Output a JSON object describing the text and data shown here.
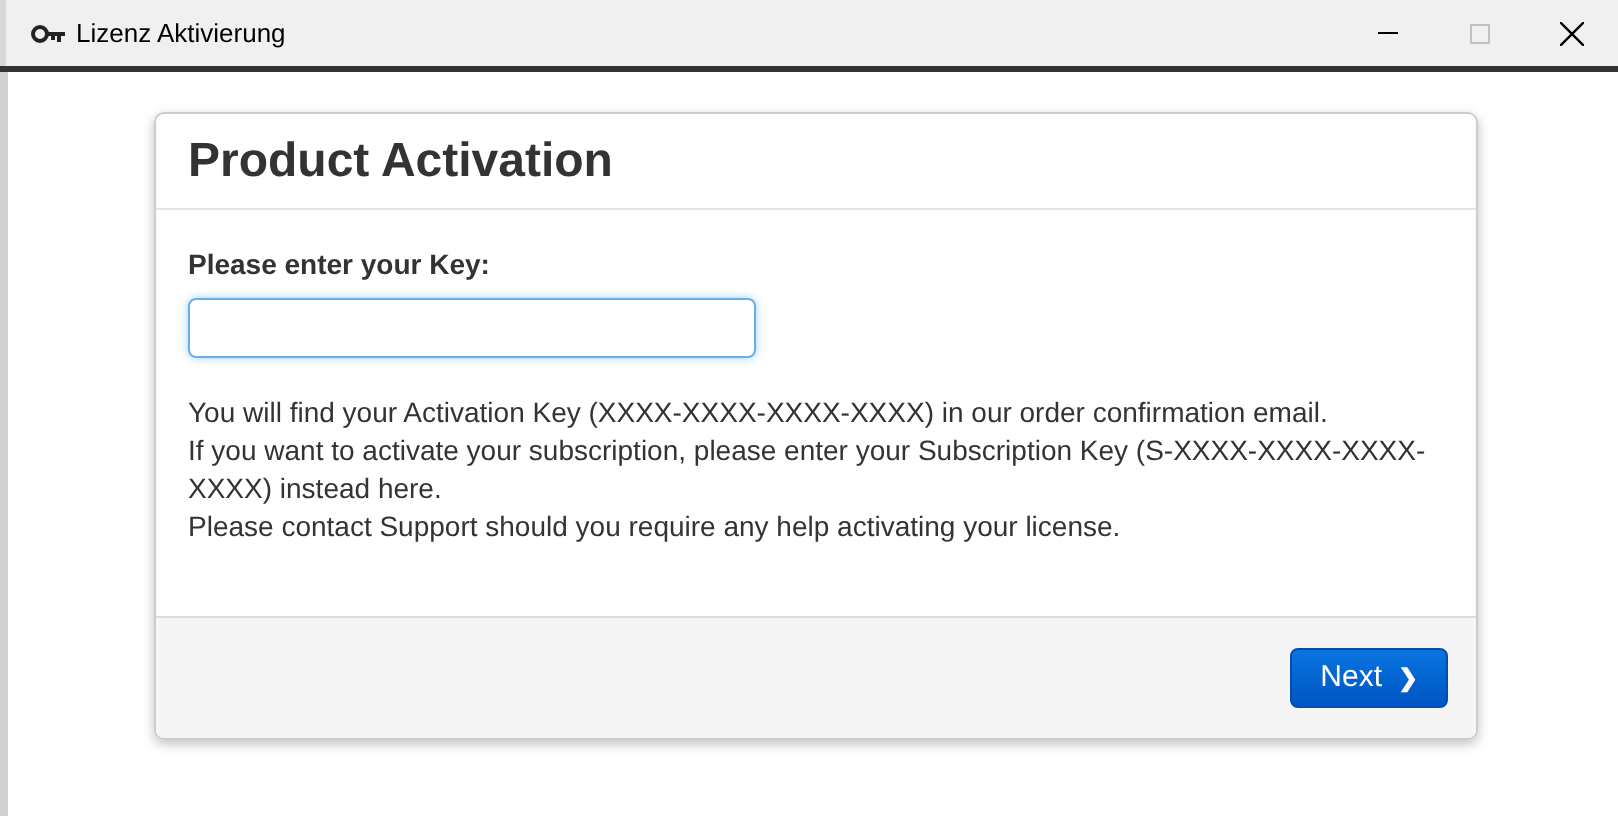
{
  "window": {
    "title": "Lizenz Aktivierung"
  },
  "panel": {
    "title": "Product Activation",
    "key_label": "Please enter your Key:",
    "paragraphs": [
      "You will find your Activation Key (XXXX-XXXX-XXXX-XXXX) in our order confirmation email.",
      "If you want to activate your subscription, please enter your Subscription Key (S-XXXX-XXXX-XXXX-XXXX) instead here.",
      "Please contact Support should you require any help activating your license."
    ],
    "next_button": {
      "label": "Next",
      "icon": "❯"
    }
  }
}
